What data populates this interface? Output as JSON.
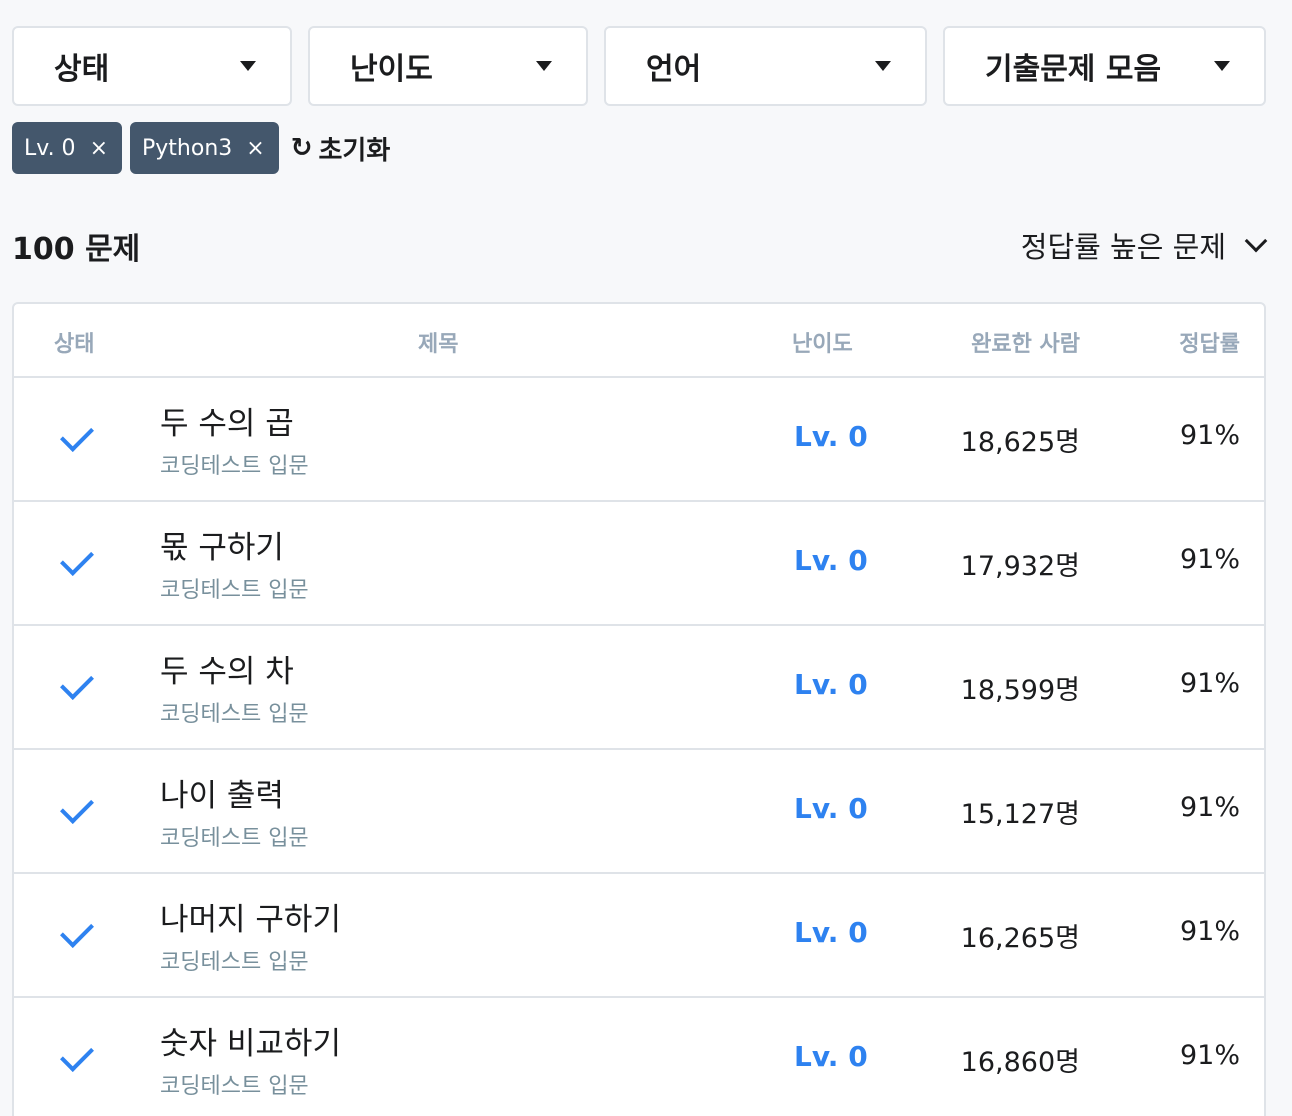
{
  "filters": {
    "status": "상태",
    "level": "난이도",
    "language": "언어",
    "exam": "기출문제 모음"
  },
  "chips": [
    {
      "label": "Lv. 0",
      "close": "×"
    },
    {
      "label": "Python3",
      "close": "×"
    }
  ],
  "reset": {
    "icon": "↻",
    "label": "초기화"
  },
  "summary": {
    "count": "100 문제",
    "sort": "정답률 높은 문제"
  },
  "table": {
    "headers": {
      "status": "상태",
      "title": "제목",
      "level": "난이도",
      "done": "완료한 사람",
      "rate": "정답률"
    },
    "rows": [
      {
        "title": "두 수의 곱",
        "sub": "코딩테스트 입문",
        "level": "Lv. 0",
        "done": "18,625명",
        "rate": "91%"
      },
      {
        "title": "몫 구하기",
        "sub": "코딩테스트 입문",
        "level": "Lv. 0",
        "done": "17,932명",
        "rate": "91%"
      },
      {
        "title": "두 수의 차",
        "sub": "코딩테스트 입문",
        "level": "Lv. 0",
        "done": "18,599명",
        "rate": "91%"
      },
      {
        "title": "나이 출력",
        "sub": "코딩테스트 입문",
        "level": "Lv. 0",
        "done": "15,127명",
        "rate": "91%"
      },
      {
        "title": "나머지 구하기",
        "sub": "코딩테스트 입문",
        "level": "Lv. 0",
        "done": "16,265명",
        "rate": "91%"
      },
      {
        "title": "숫자 비교하기",
        "sub": "코딩테스트 입문",
        "level": "Lv. 0",
        "done": "16,860명",
        "rate": "91%"
      }
    ]
  },
  "colors": {
    "accent": "#2e82f0",
    "chip": "#44576c",
    "muted": "#98a8b9",
    "border": "#dfe3e8"
  }
}
